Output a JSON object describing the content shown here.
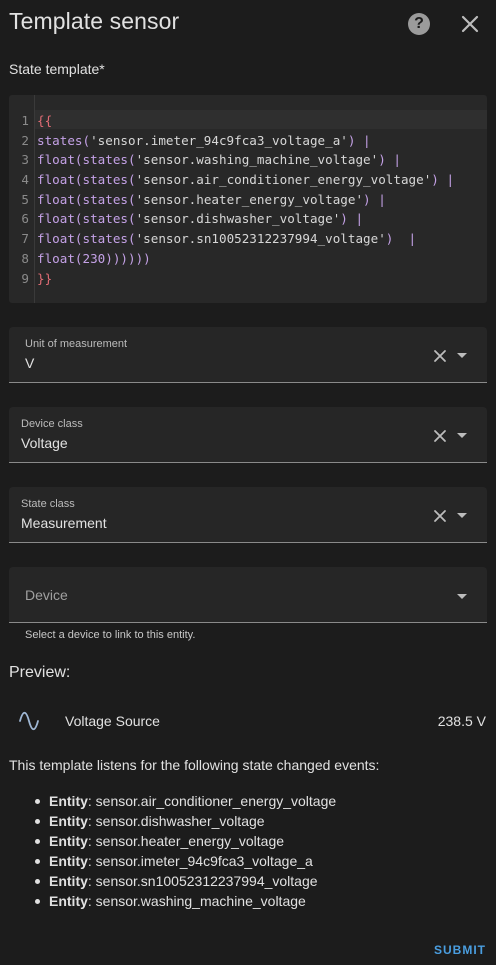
{
  "dialog": {
    "title": "Template sensor"
  },
  "state_template": {
    "label": "State template*",
    "lines": [
      {
        "n": "1",
        "text": "{{"
      },
      {
        "n": "2",
        "text": "states('sensor.imeter_94c9fca3_voltage_a') |"
      },
      {
        "n": "3",
        "text": "float(states('sensor.washing_machine_voltage') |"
      },
      {
        "n": "4",
        "text": "float(states('sensor.air_conditioner_energy_voltage') |"
      },
      {
        "n": "5",
        "text": "float(states('sensor.heater_energy_voltage') |"
      },
      {
        "n": "6",
        "text": "float(states('sensor.dishwasher_voltage') |"
      },
      {
        "n": "7",
        "text": "float(states('sensor.sn10052312237994_voltage')  |"
      },
      {
        "n": "8",
        "text": "float(230))))))"
      },
      {
        "n": "9",
        "text": "}}"
      }
    ]
  },
  "fields": {
    "unit": {
      "label": "Unit of measurement",
      "value": "V"
    },
    "device_class": {
      "label": "Device class",
      "value": "Voltage"
    },
    "state_class": {
      "label": "State class",
      "value": "Measurement"
    },
    "device": {
      "placeholder": "Device",
      "helper": "Select a device to link to this entity."
    }
  },
  "preview": {
    "label": "Preview:",
    "entity_name": "Voltage Source",
    "entity_state": "238.5 V",
    "icon": "sine-wave-icon"
  },
  "listens": {
    "intro": "This template listens for the following state changed events:",
    "key": "Entity",
    "entities": [
      "sensor.air_conditioner_energy_voltage",
      "sensor.dishwasher_voltage",
      "sensor.heater_energy_voltage",
      "sensor.imeter_94c9fca3_voltage_a",
      "sensor.sn10052312237994_voltage",
      "sensor.washing_machine_voltage"
    ]
  },
  "actions": {
    "submit": "SUBMIT"
  },
  "colors": {
    "background": "#1c1c1c",
    "accent": "#4a9ee0",
    "code_brace": "#e06c75",
    "code_fn": "#c4a1e6"
  }
}
